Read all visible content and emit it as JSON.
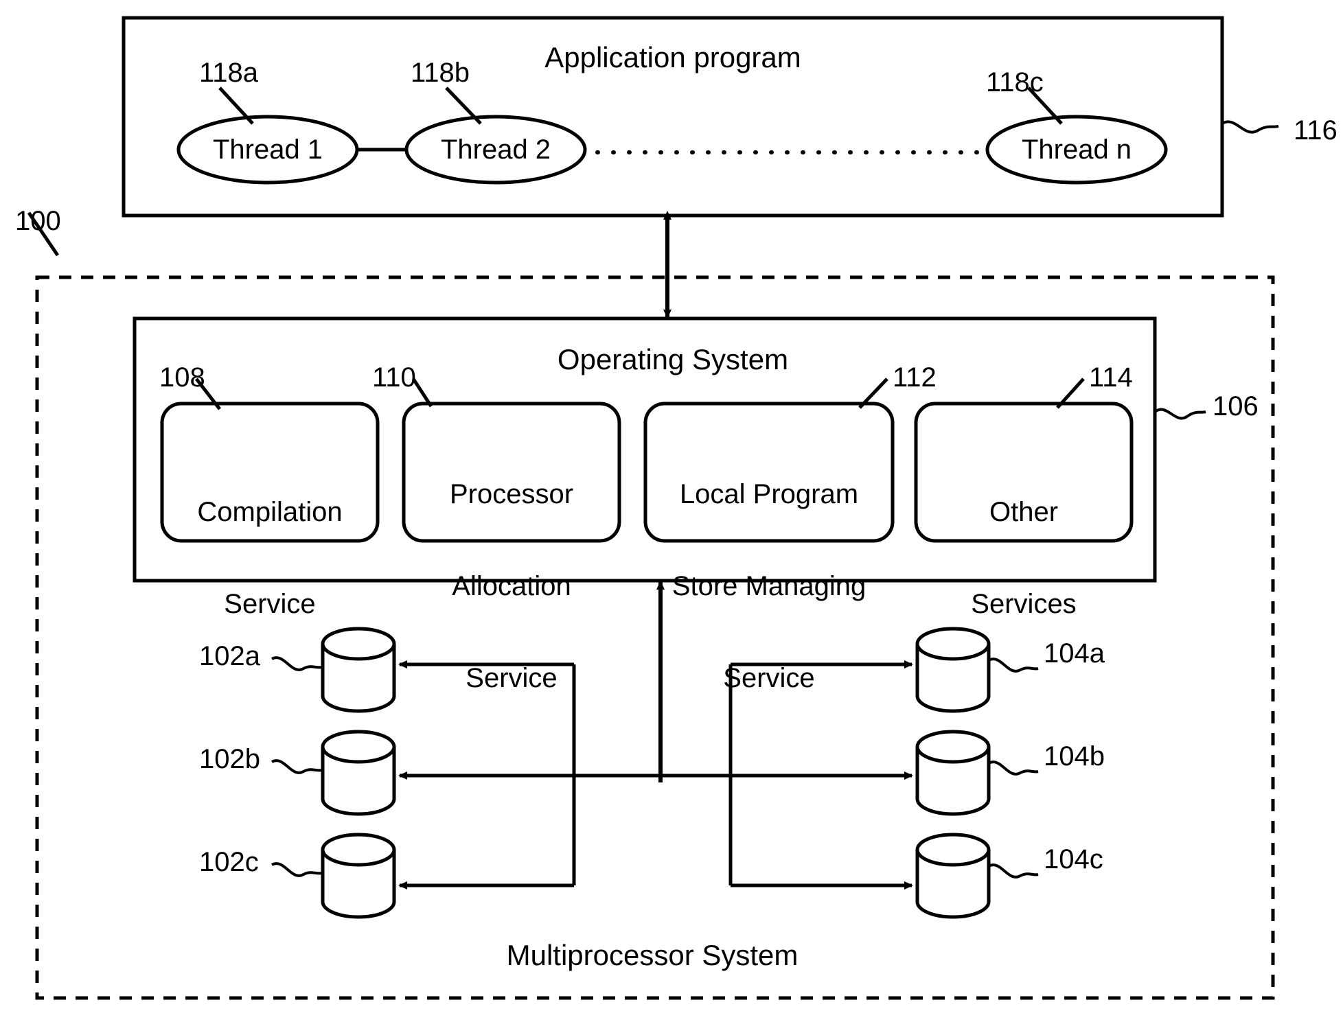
{
  "figure": {
    "title_app": "Application program",
    "title_os": "Operating System",
    "title_mps": "Multiprocessor System"
  },
  "reference_numerals": {
    "system": "100",
    "app_program": "116",
    "os_box": "106",
    "compilation_service": "108",
    "processor_allocation_service": "110",
    "local_program_store_managing_service": "112",
    "other_services": "114",
    "thread1": "118a",
    "thread2": "118b",
    "threadn": "118c",
    "left_cyl_a": "102a",
    "left_cyl_b": "102b",
    "left_cyl_c": "102c",
    "right_cyl_a": "104a",
    "right_cyl_b": "104b",
    "right_cyl_c": "104c"
  },
  "threads": [
    {
      "label": "Thread 1",
      "ref": "118a"
    },
    {
      "label": "Thread 2",
      "ref": "118b"
    },
    {
      "label": "Thread n",
      "ref": "118c"
    }
  ],
  "services": [
    {
      "ref": "108",
      "line1": "Compilation",
      "line2": "Service",
      "line3": ""
    },
    {
      "ref": "110",
      "line1": "Processor",
      "line2": "Allocation",
      "line3": "Service"
    },
    {
      "ref": "112",
      "line1": "Local Program",
      "line2": "Store Managing",
      "line3": "Service"
    },
    {
      "ref": "114",
      "line1": "Other",
      "line2": "Services",
      "line3": ""
    }
  ],
  "left_cylinders": [
    {
      "ref": "102a"
    },
    {
      "ref": "102b"
    },
    {
      "ref": "102c"
    }
  ],
  "right_cylinders": [
    {
      "ref": "104a"
    },
    {
      "ref": "104b"
    },
    {
      "ref": "104c"
    }
  ],
  "colors": {
    "stroke": "#000000",
    "background": "#ffffff"
  }
}
